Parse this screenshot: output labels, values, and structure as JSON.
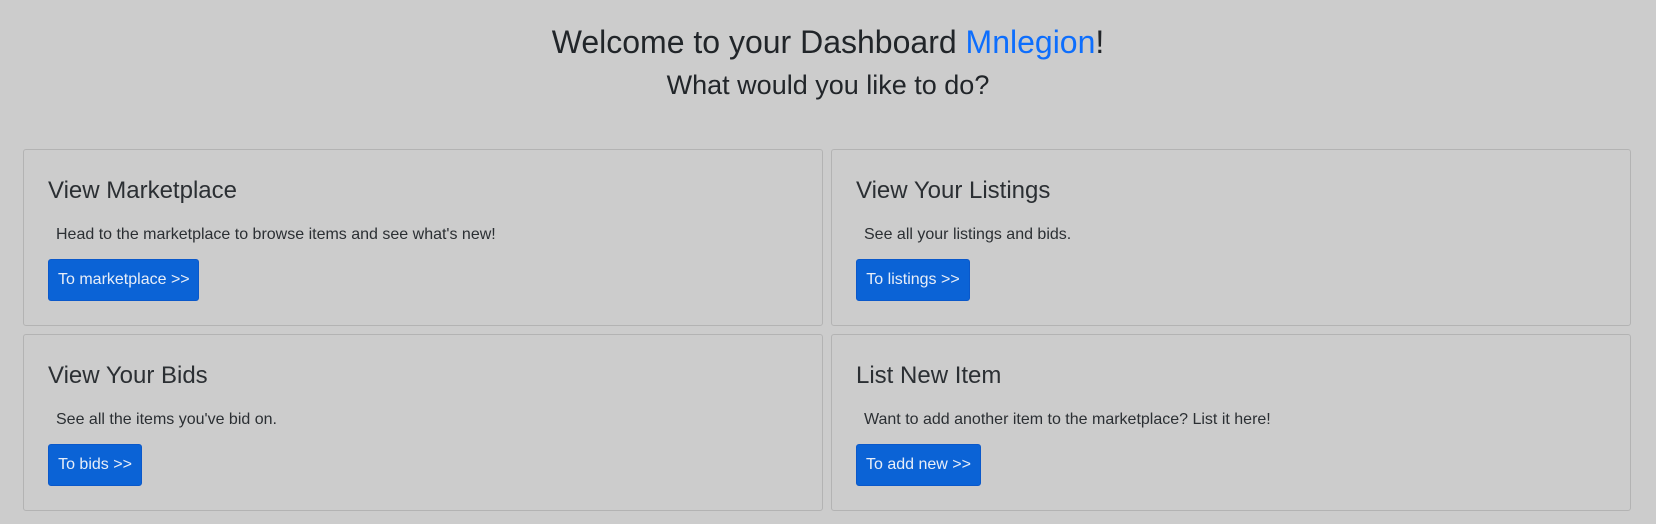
{
  "header": {
    "title_prefix": "Welcome to your Dashboard ",
    "username": "Mnlegion",
    "title_suffix": "!",
    "subtitle": "What would you like to do?"
  },
  "cards": [
    {
      "title": "View Marketplace",
      "text": "Head to the marketplace to browse items and see what's new!",
      "button": "To marketplace >>"
    },
    {
      "title": "View Your Listings",
      "text": "See all your listings and bids.",
      "button": "To listings >>"
    },
    {
      "title": "View Your Bids",
      "text": "See all the items you've bid on.",
      "button": "To bids >>"
    },
    {
      "title": "List New Item",
      "text": "Want to add another item to the marketplace? List it here!",
      "button": "To add new >>"
    }
  ],
  "colors": {
    "background": "#cccccc",
    "accent": "#0d6efd",
    "button": "#0b63d6"
  }
}
